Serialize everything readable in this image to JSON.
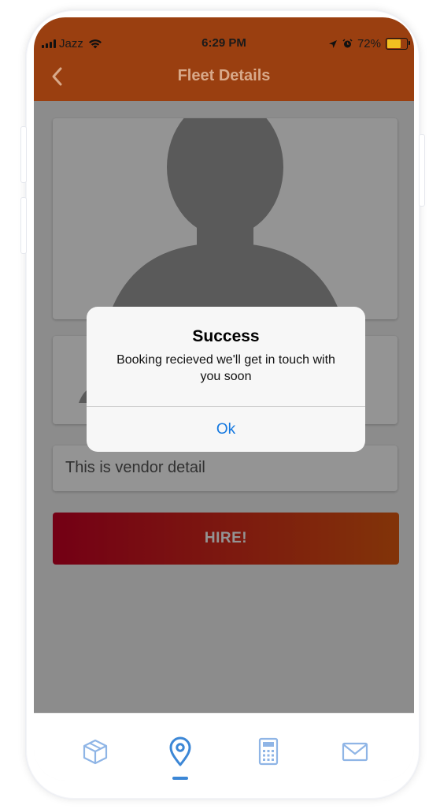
{
  "status_bar": {
    "carrier": "Jazz",
    "time": "6:29 PM",
    "battery": "72%",
    "battery_level": 0.72,
    "icons": [
      "signal-icon",
      "wifi-icon",
      "location-arrow-icon",
      "alarm-icon",
      "battery-icon"
    ]
  },
  "header": {
    "title": "Fleet Details",
    "back_icon": "chevron-left-icon",
    "color": "#9a3f10"
  },
  "vendor": {
    "photo_icon": "person-silhouette-icon",
    "description": "This is vendor detail"
  },
  "hire_button": {
    "label": "HIRE!",
    "colors": [
      "#c80025",
      "#e05a10"
    ]
  },
  "alert": {
    "title": "Success",
    "message": "Booking recieved we'll get in touch with you soon",
    "ok_label": "Ok",
    "ok_color": "#1478e0"
  },
  "tab_bar": {
    "tabs": [
      {
        "icon": "package-box-icon",
        "active": false
      },
      {
        "icon": "location-pin-icon",
        "active": true
      },
      {
        "icon": "calculator-icon",
        "active": false
      },
      {
        "icon": "envelope-icon",
        "active": false
      }
    ],
    "accent": "#3c87d6"
  }
}
